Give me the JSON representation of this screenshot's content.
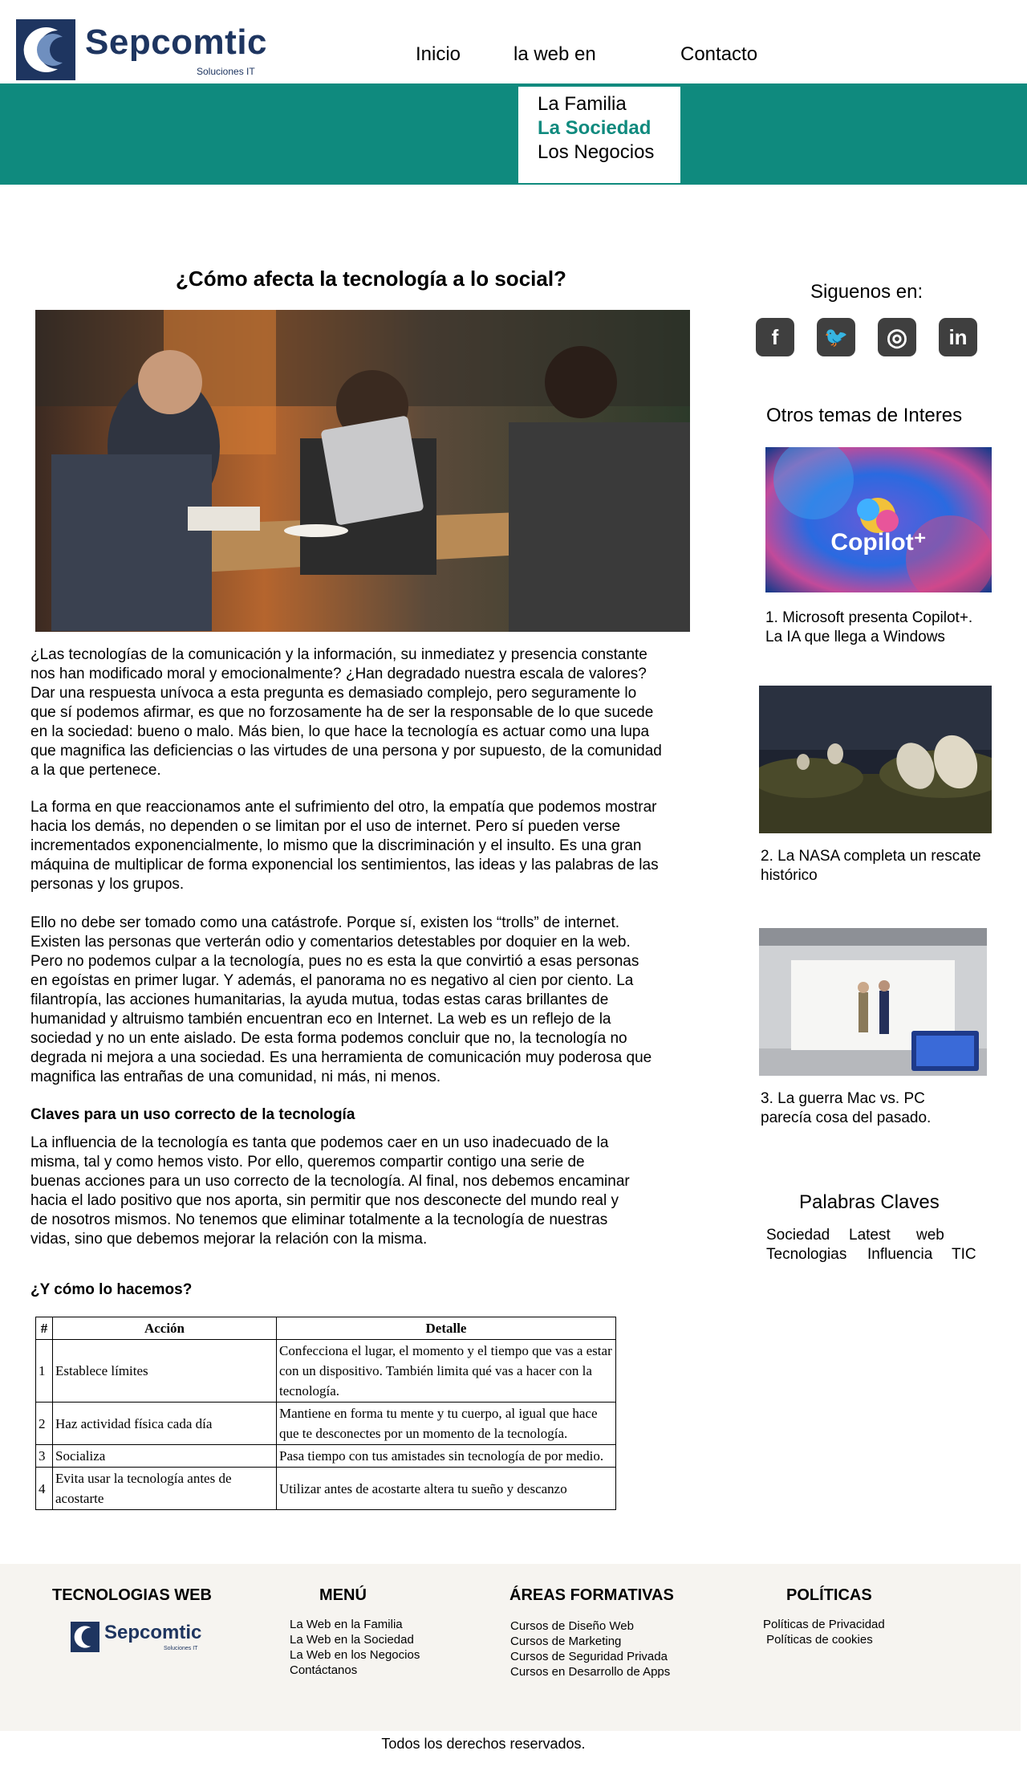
{
  "brand": {
    "name": "Sepcomtic",
    "tagline": "Soluciones IT"
  },
  "nav": {
    "items": [
      "Inicio",
      "la web en",
      "Contacto"
    ]
  },
  "dropdown": {
    "items": [
      "La Familia",
      "La Sociedad",
      "Los Negocios"
    ],
    "active_color": "#0f8a7e"
  },
  "colors": {
    "teal": "#0f8a7e",
    "brand_navy": "#1e3560",
    "footer_bg": "#f6f4f0"
  },
  "article": {
    "title": "¿Cómo afecta la tecnología a lo social?",
    "hero_alt": "",
    "paragraphs": [
      "¿Las tecnologías de la comunicación y la información, su inmediatez y presencia constante\n nos han modificado moral y emocionalmente? ¿Han degradado nuestra escala de valores?\n Dar una respuesta unívoca a esta pregunta es demasiado complejo, pero seguramente lo\nque sí podemos afirmar, es que no forzosamente ha de ser la responsable de lo que sucede\nen la sociedad: bueno o malo. Más bien, lo que hace la tecnología es actuar como una lupa\nque magnifica las deficiencias o las virtudes de una persona y por supuesto, de la comunidad\n a la que pertenece.",
      "La forma en que reaccionamos ante el sufrimiento del otro, la empatía que podemos mostrar\nhacia los demás, no dependen o se limitan por el uso de internet. Pero sí pueden verse\n incrementados exponencialmente, lo mismo que la discriminación y el insulto. Es una gran\nmáquina de multiplicar de forma exponencial los sentimientos, las ideas y las palabras de las\npersonas y los grupos.",
      "Ello no debe ser tomado como una catástrofe. Porque sí, existen los “trolls” de internet.\nExisten las personas que verterán odio y comentarios detestables por doquier en la web.\nPero no podemos culpar a la tecnología, pues no es esta la que convirtió a esas personas\n en egoístas en primer lugar. Y además, el panorama no es negativo al cien por ciento. La\n filantropía, las acciones humanitarias, la ayuda mutua, todas estas caras brillantes de\nhumanidad y altruismo también encuentran eco en Internet. La web es un reflejo de la\nsociedad y no un ente aislado. De esta forma podemos concluir que no, la tecnología no\ndegrada ni mejora a una sociedad. Es una herramienta de comunicación muy poderosa que\nmagnifica las entrañas de una comunidad, ni más, ni menos."
    ],
    "claves_heading": "Claves para un uso correcto de la tecnología",
    "claves_paragraph": "La influencia de la tecnología es tanta que podemos caer en un uso inadecuado de la\nmisma, tal y como hemos visto. Por ello, queremos compartir contigo una serie de\nbuenas acciones para un uso correcto de la tecnología. Al final, nos debemos encaminar\n hacia el lado positivo que nos aporta, sin permitir que nos desconecte del mundo real y\n de nosotros mismos. No tenemos que eliminar totalmente a la tecnología de nuestras\nvidas, sino que debemos mejorar la relación con la misma.",
    "how_heading": "¿Y cómo lo hacemos?"
  },
  "table": {
    "headers": [
      "#",
      "Acción",
      "Detalle"
    ],
    "rows": [
      {
        "n": "1",
        "accion": "Establece límites",
        "detalle": "Confecciona el lugar, el momento y el tiempo que vas a estar con un dispositivo. También limita qué vas a hacer con la tecnología."
      },
      {
        "n": "2",
        "accion": "Haz actividad física cada día",
        "detalle": "Mantiene en forma tu mente y tu cuerpo, al igual que hace que te desconectes por un momento de la tecnología."
      },
      {
        "n": "3",
        "accion": "Socializa",
        "detalle": "Pasa tiempo con tus amistades sin tecnología de por medio."
      },
      {
        "n": "4",
        "accion": "Evita usar la tecnología antes de acostarte",
        "detalle": "Utilizar antes de acostarte altera tu sueño y descanzo"
      }
    ]
  },
  "sidebar": {
    "follow_heading": "Siguenos en:",
    "social": [
      {
        "icon": "facebook-icon",
        "glyph": "f"
      },
      {
        "icon": "twitter-icon",
        "glyph": "🐦"
      },
      {
        "icon": "instagram-icon",
        "glyph": "◎"
      },
      {
        "icon": "linkedin-icon",
        "glyph": "in"
      }
    ],
    "topics_heading": "Otros temas de Interes",
    "topics": [
      {
        "caption": "1. Microsoft presenta Copilot+.\nLa IA que llega a Windows",
        "image_text": "Copilot⁺"
      },
      {
        "caption": "2. La NASA completa un rescate\n histórico"
      },
      {
        "caption": "3. La guerra Mac vs. PC\nparecía cosa del pasado."
      }
    ],
    "keywords_heading": "Palabras Claves",
    "keywords": [
      "Sociedad",
      "Latest",
      "web",
      "Tecnologias",
      "Influencia",
      "TIC"
    ]
  },
  "footer": {
    "col1": {
      "heading": "TECNOLOGIAS WEB"
    },
    "col2": {
      "heading": "MENÚ",
      "links": [
        "La Web en la Familia",
        "La Web en la Sociedad",
        "La Web en los Negocios",
        "Contáctanos"
      ]
    },
    "col3": {
      "heading": "ÁREAS FORMATIVAS",
      "links": [
        "Cursos de Diseño Web",
        "Cursos de Marketing",
        "Cursos de Seguridad Privada",
        "Cursos en Desarrollo de Apps"
      ]
    },
    "col4": {
      "heading": "POLÍTICAS",
      "links": [
        "Políticas de Privacidad",
        " Políticas de cookies"
      ]
    },
    "copyright": "Todos los derechos reservados."
  }
}
